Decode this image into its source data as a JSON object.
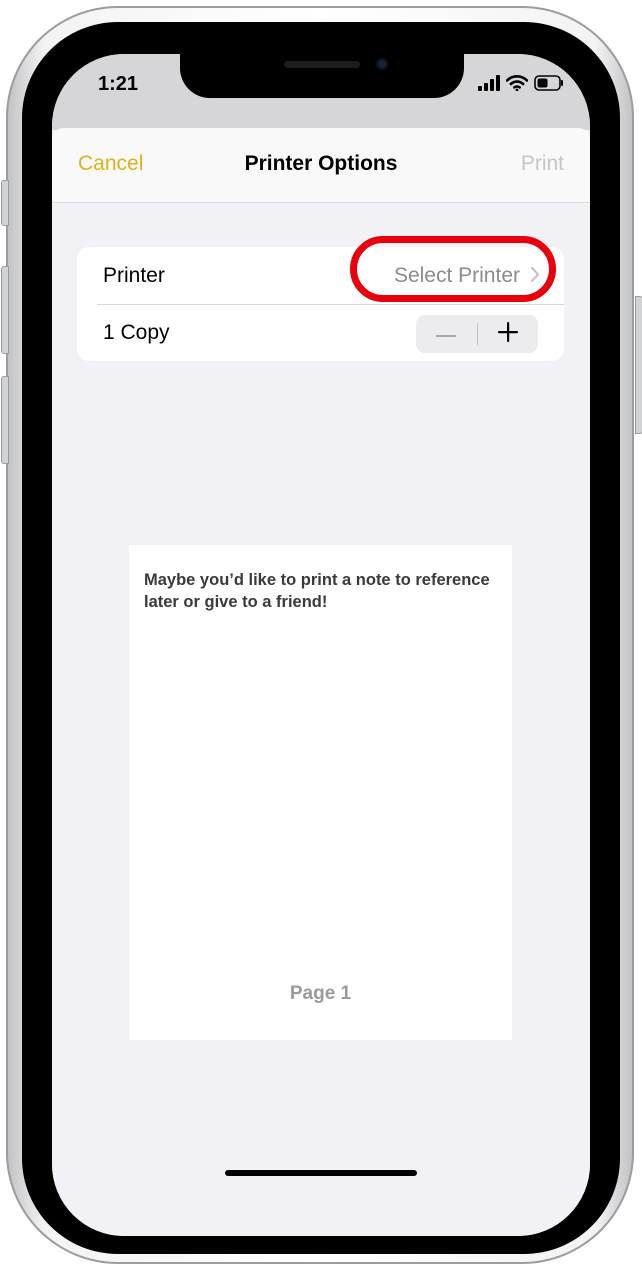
{
  "status_bar": {
    "time": "1:21"
  },
  "nav": {
    "cancel_label": "Cancel",
    "title": "Printer Options",
    "print_label": "Print"
  },
  "options": {
    "printer_label": "Printer",
    "printer_value": "Select Printer",
    "copies_label": "1 Copy"
  },
  "preview": {
    "text": "Maybe you’d like to print a note to reference later or give to a friend!",
    "page_label": "Page 1"
  },
  "colors": {
    "accent": "#e0b11c",
    "highlight": "#e8000c",
    "disabled": "#c6c6c8"
  },
  "icons": [
    "cellular-signal-icon",
    "wifi-icon",
    "battery-icon",
    "chevron-right-icon",
    "minus-icon",
    "plus-icon"
  ]
}
